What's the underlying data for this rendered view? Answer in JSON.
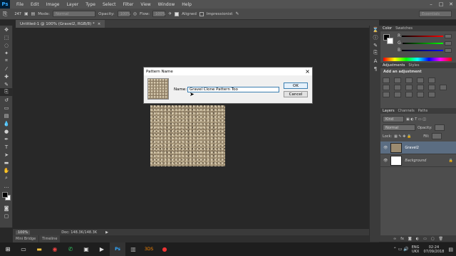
{
  "app": {
    "logo": "Ps",
    "menus": [
      "File",
      "Edit",
      "Image",
      "Layer",
      "Type",
      "Select",
      "Filter",
      "View",
      "Window",
      "Help"
    ]
  },
  "options": {
    "brush_size": "247",
    "mode_label": "Mode:",
    "mode": "Normal",
    "opacity_label": "Opacity:",
    "opacity": "100%",
    "flow_label": "Flow:",
    "flow": "100%",
    "aligned_label": "Aligned",
    "impressionist_label": "Impressionist",
    "workspace": "Essentials"
  },
  "document": {
    "tab_title": "Untitled-1 @ 100% (Gravel2, RGB/8) *",
    "close": "×"
  },
  "status": {
    "zoom": "100%",
    "doc": "Doc: 148.3K/148.3K"
  },
  "bottom_tabs": [
    "Mini Bridge",
    "Timeline"
  ],
  "panels": {
    "color_tabs": [
      "Color",
      "Swatches"
    ],
    "color_channels": [
      "R",
      "G",
      "B"
    ],
    "adjust_tabs": [
      "Adjustments",
      "Styles"
    ],
    "adjust_title": "Add an adjustment",
    "layers_tabs": [
      "Layers",
      "Channels",
      "Paths"
    ],
    "kind": "Kind",
    "blend_mode": "Normal",
    "opacity_label": "Opacity:",
    "lock_label": "Lock:",
    "fill_label": "Fill:",
    "layers": [
      {
        "name": "Gravel2"
      },
      {
        "name": "Background"
      }
    ]
  },
  "dialog": {
    "title": "Pattern Name",
    "close": "×",
    "name_label": "Name:",
    "name_value": "Gravel Clone Pattern Too",
    "ok": "OK",
    "cancel": "Cancel"
  },
  "taskbar": {
    "lang": "ENG",
    "region": "UKX",
    "time": "02:24",
    "date": "07/09/2018"
  },
  "colors": {
    "ps_blue": "#31a8ff",
    "accent": "#3c7fb1",
    "taskbar": "#1e1e1e",
    "canvas_bg": "#282828"
  }
}
